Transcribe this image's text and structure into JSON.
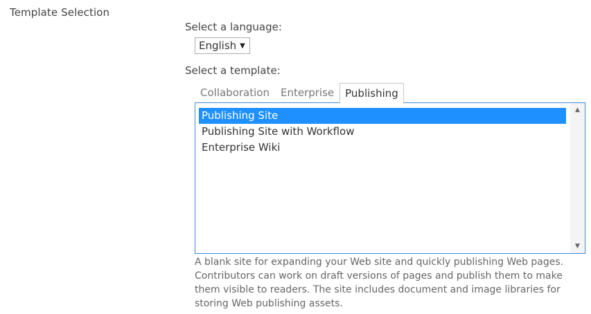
{
  "section": {
    "title": "Template Selection"
  },
  "language": {
    "label": "Select a language:",
    "selected": "English",
    "arrow_icon": "caret-down-icon"
  },
  "template": {
    "label": "Select a template:",
    "tabs": [
      {
        "label": "Collaboration",
        "active": false
      },
      {
        "label": "Enterprise",
        "active": false
      },
      {
        "label": "Publishing",
        "active": true
      }
    ],
    "items": [
      {
        "label": "Publishing Site",
        "selected": true
      },
      {
        "label": "Publishing Site with Workflow",
        "selected": false
      },
      {
        "label": "Enterprise Wiki",
        "selected": false
      }
    ],
    "description": "A blank site for expanding your Web site and quickly publishing Web pages. Contributors can work on draft versions of pages and publish them to make them visible to readers. The site includes document and image libraries for storing Web publishing assets."
  },
  "colors": {
    "selection": "#1e90ff",
    "listbox_border": "#3e8ad8"
  }
}
